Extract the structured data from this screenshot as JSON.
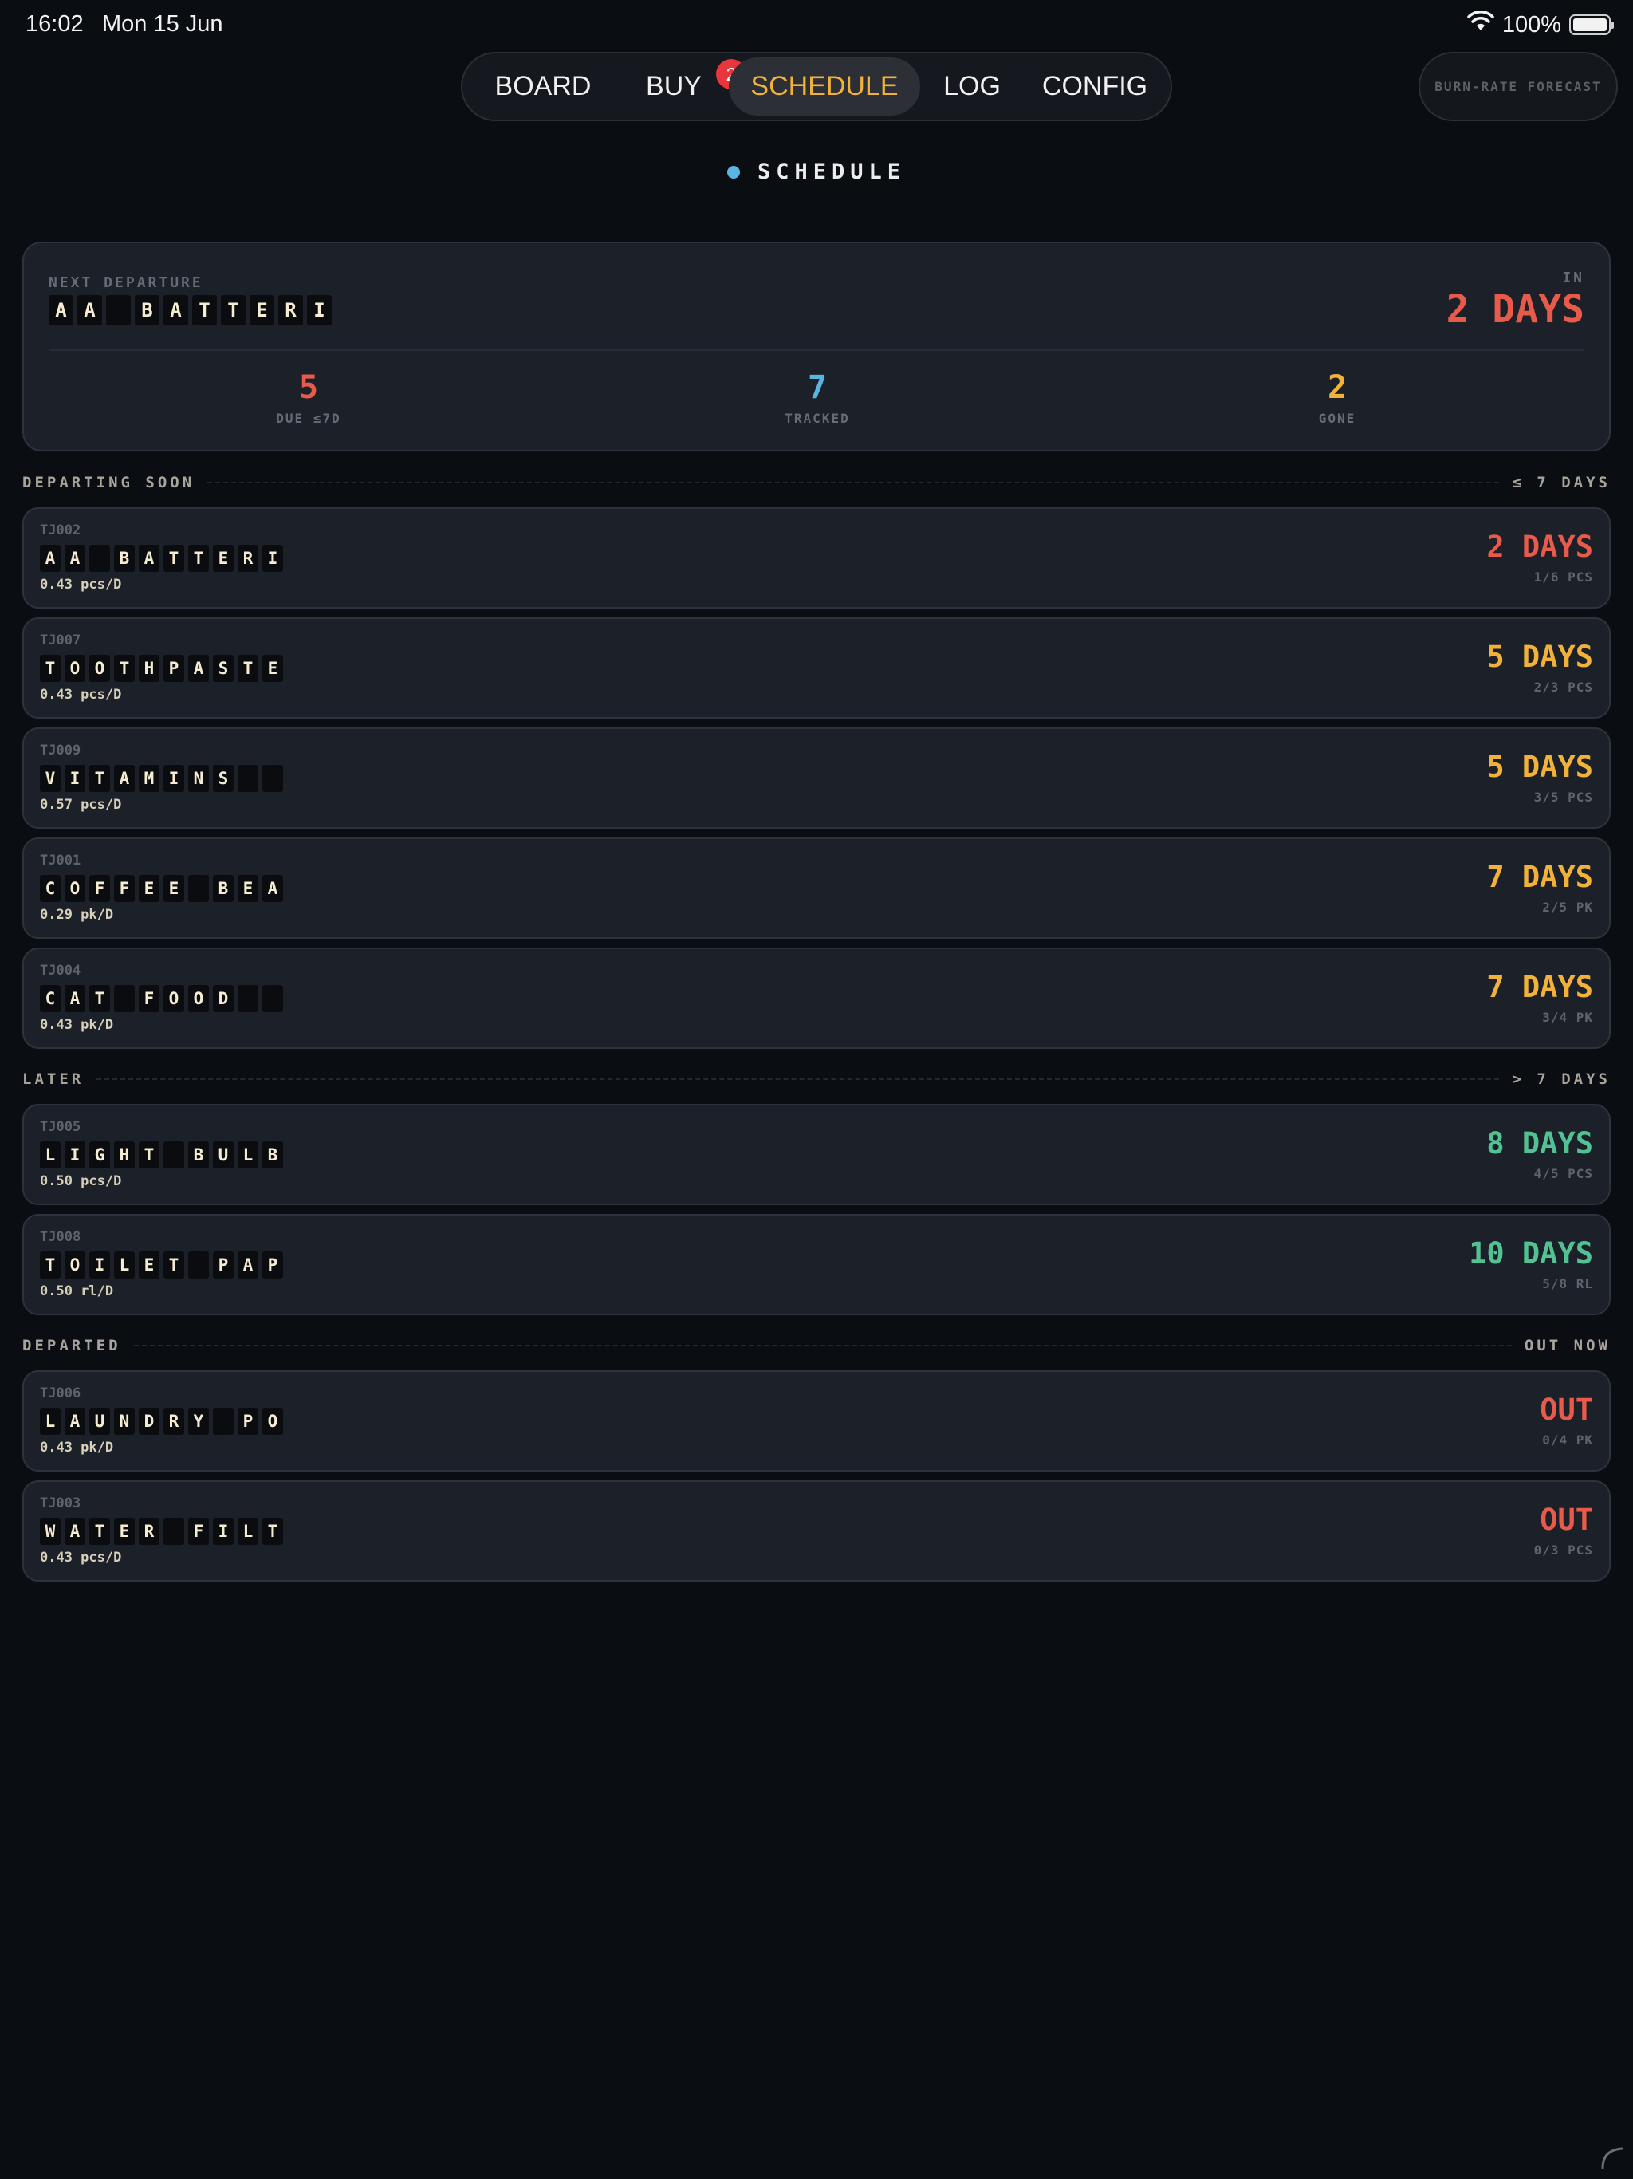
{
  "status_bar": {
    "time": "16:02",
    "date": "Mon 15 Jun",
    "battery": "100%"
  },
  "nav": {
    "tabs": [
      {
        "label": "BOARD"
      },
      {
        "label": "BUY",
        "badge": "2"
      },
      {
        "label": "SCHEDULE",
        "active": true
      },
      {
        "label": "LOG"
      },
      {
        "label": "CONFIG"
      }
    ],
    "forecast_label": "BURN-RATE FORECAST"
  },
  "page": {
    "heading": "SCHEDULE"
  },
  "summary": {
    "label": "NEXT DEPARTURE",
    "item_name": "AA BATTERI",
    "in_label": "IN",
    "eta": "2 DAYS",
    "stats": [
      {
        "value": "5",
        "label": "DUE ≤7D",
        "color": "#e85a4a"
      },
      {
        "value": "7",
        "label": "TRACKED",
        "color": "#58b6e0"
      },
      {
        "value": "2",
        "label": "GONE",
        "color": "#f2b23a"
      }
    ]
  },
  "groups": {
    "soon": {
      "title": "DEPARTING SOON",
      "right": "≤ 7 DAYS"
    },
    "later": {
      "title": "LATER",
      "right": "> 7 DAYS"
    },
    "departed": {
      "title": "DEPARTED",
      "right": "OUT NOW"
    }
  },
  "items": [
    {
      "code": "TJ002",
      "name": "AA BATTERI",
      "rate": "0.43 pcs/D",
      "eta": "2 DAYS",
      "qty": "1/6 PCS",
      "color": "#e85a4a"
    },
    {
      "code": "TJ007",
      "name": "TOOTHPASTE",
      "rate": "0.43 pcs/D",
      "eta": "5 DAYS",
      "qty": "2/3 PCS",
      "color": "#f2b23a"
    },
    {
      "code": "TJ009",
      "name": "VITAMINS",
      "rate": "0.57 pcs/D",
      "eta": "5 DAYS",
      "qty": "3/5 PCS",
      "color": "#f2b23a"
    },
    {
      "code": "TJ001",
      "name": "COFFEE BEA",
      "rate": "0.29 pk/D",
      "eta": "7 DAYS",
      "qty": "2/5 PK",
      "color": "#f2b23a"
    },
    {
      "code": "TJ004",
      "name": "CAT FOOD",
      "rate": "0.43 pk/D",
      "eta": "7 DAYS",
      "qty": "3/4 PK",
      "color": "#f2b23a"
    },
    {
      "code": "TJ005",
      "name": "LIGHT BULB",
      "rate": "0.50 pcs/D",
      "eta": "8 DAYS",
      "qty": "4/5 PCS",
      "color": "#52c293"
    },
    {
      "code": "TJ008",
      "name": "TOILET PAP",
      "rate": "0.50 rl/D",
      "eta": "10 DAYS",
      "qty": "5/8 RL",
      "color": "#52c293"
    },
    {
      "code": "TJ006",
      "name": "LAUNDRY PO",
      "rate": "0.43 pk/D",
      "eta": "OUT",
      "qty": "0/4 PK",
      "color": "#e85a4a"
    },
    {
      "code": "TJ003",
      "name": "WATER FILT",
      "rate": "0.43 pcs/D",
      "eta": "OUT",
      "qty": "0/3 PCS",
      "color": "#e85a4a"
    }
  ]
}
